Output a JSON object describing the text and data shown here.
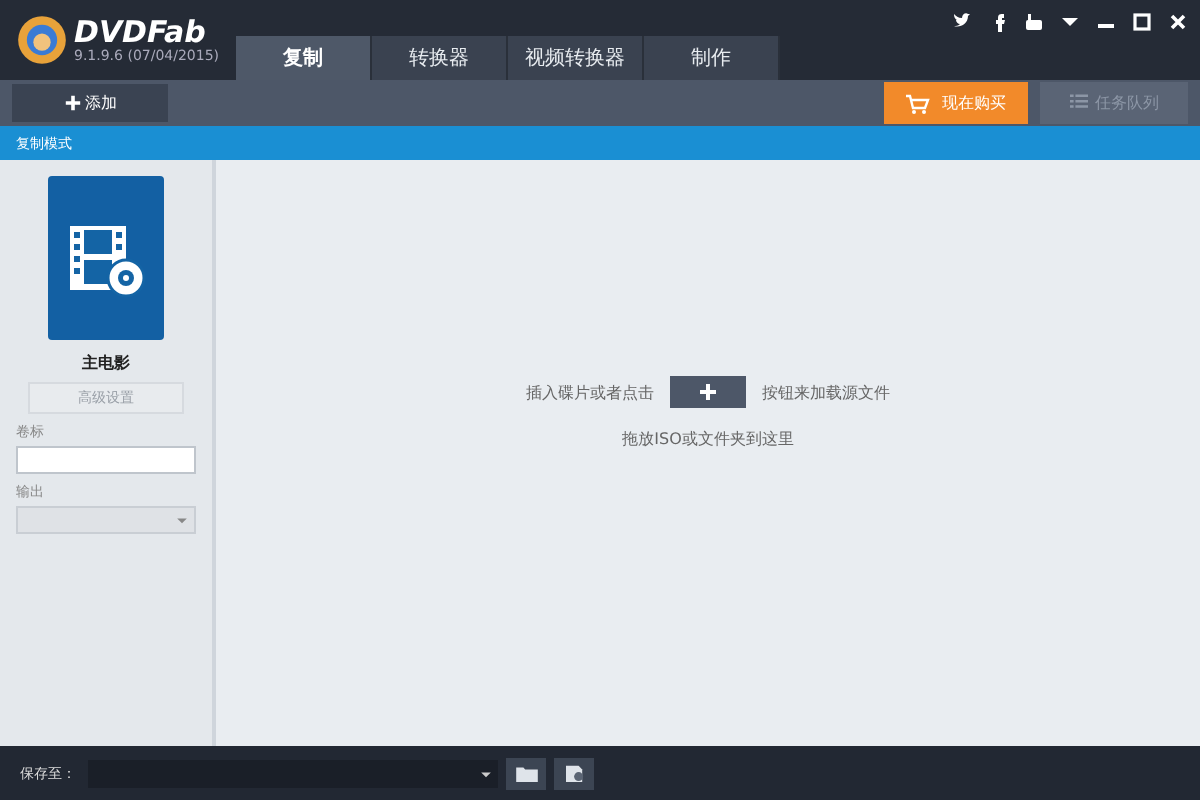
{
  "app": {
    "name": "DVDFab",
    "version": "9.1.9.6 (07/04/2015)"
  },
  "tabs": [
    {
      "label": "复制",
      "selected": true
    },
    {
      "label": "转换器",
      "selected": false
    },
    {
      "label": "视频转换器",
      "selected": false
    },
    {
      "label": "制作",
      "selected": false
    }
  ],
  "toolbar": {
    "add_button": "添加",
    "buy_button": "现在购买",
    "queue_button": {
      "label": "任务队列",
      "disabled": true
    }
  },
  "mode_bar": {
    "title": "复制模式"
  },
  "sidebar": {
    "mode_name": "主电影",
    "advanced_button": {
      "label": "高级设置",
      "disabled": true
    },
    "volume_label": "卷标",
    "output_label": "输出"
  },
  "main": {
    "hint_before": "插入碟片或者点击",
    "hint_after": "按钮来加载源文件",
    "hint_drop": "拖放ISO或文件夹到这里"
  },
  "status_bar": {
    "save_label": "保存至："
  }
}
